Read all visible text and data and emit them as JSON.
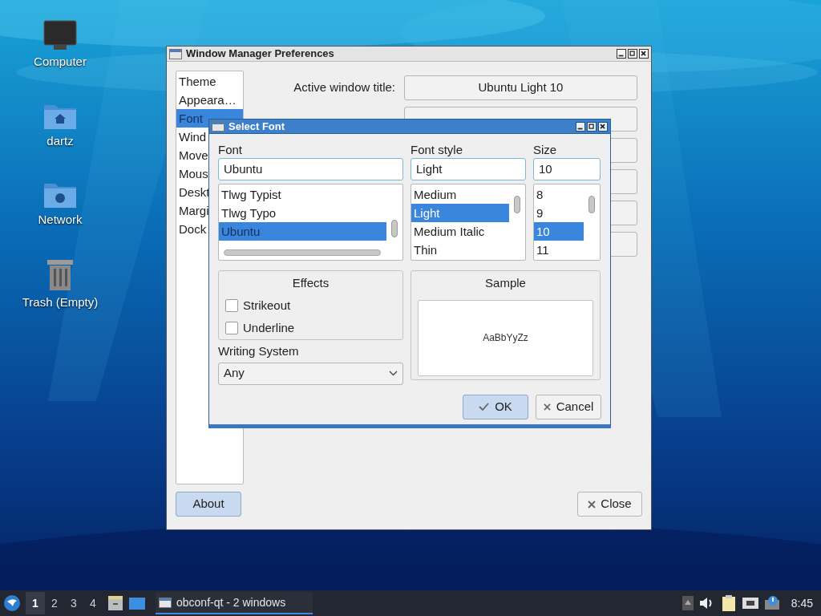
{
  "desktop_icons": [
    {
      "label": "Computer",
      "kind": "computer"
    },
    {
      "label": "dartz",
      "kind": "home"
    },
    {
      "label": "Network",
      "kind": "network"
    },
    {
      "label": "Trash (Empty)",
      "kind": "trash"
    }
  ],
  "main_window": {
    "title": "Window Manager Preferences",
    "sidebar": [
      {
        "label": "Theme",
        "selected": false
      },
      {
        "label": "Appeara…",
        "selected": false
      },
      {
        "label": "Font",
        "selected": true
      },
      {
        "label": "Wind",
        "selected": false
      },
      {
        "label": "Move",
        "selected": false
      },
      {
        "label": "Mous",
        "selected": false
      },
      {
        "label": "Deskt",
        "selected": false
      },
      {
        "label": "Margi",
        "selected": false
      },
      {
        "label": "Dock",
        "selected": false
      }
    ],
    "fields": [
      {
        "label": "Active window title:",
        "value": "Ubuntu Light 10"
      }
    ],
    "about_button": "About",
    "close_button": "Close"
  },
  "dialog": {
    "title": "Select Font",
    "font": {
      "label": "Font",
      "value": "Ubuntu",
      "items": [
        {
          "label": "Tlwg Typist",
          "selected": false
        },
        {
          "label": "Tlwg Typo",
          "selected": false
        },
        {
          "label": "Ubuntu",
          "selected": true
        }
      ]
    },
    "style": {
      "label": "Font style",
      "value": "Light",
      "items": [
        {
          "label": "Medium",
          "selected": false
        },
        {
          "label": "Light",
          "selected": true
        },
        {
          "label": "Medium Italic",
          "selected": false
        },
        {
          "label": "Thin",
          "selected": false
        }
      ]
    },
    "size": {
      "label": "Size",
      "value": "10",
      "items": [
        {
          "label": "8",
          "selected": false
        },
        {
          "label": "9",
          "selected": false
        },
        {
          "label": "10",
          "selected": true
        },
        {
          "label": "11",
          "selected": false
        }
      ]
    },
    "effects": {
      "title": "Effects",
      "options": [
        {
          "label": "Strikeout",
          "checked": false
        },
        {
          "label": "Underline",
          "checked": false
        }
      ]
    },
    "writing_system": {
      "label": "Writing System",
      "value": "Any"
    },
    "sample": {
      "title": "Sample",
      "text": "AaBbYyZz"
    },
    "ok_button": "OK",
    "cancel_button": "Cancel"
  },
  "taskbar": {
    "workspaces": [
      {
        "label": "1",
        "selected": true
      },
      {
        "label": "2",
        "selected": false
      },
      {
        "label": "3",
        "selected": false
      },
      {
        "label": "4",
        "selected": false
      }
    ],
    "task": "obconf-qt - 2 windows",
    "clock": "8:45"
  }
}
